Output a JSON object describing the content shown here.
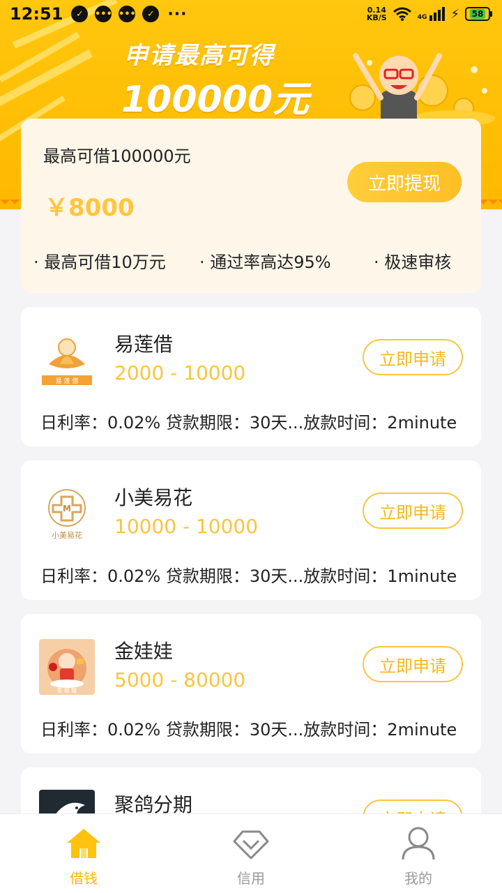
{
  "status_bar": {
    "time": "12:51",
    "speed_value": "0.14",
    "speed_unit": "KB/S",
    "network": "4G",
    "battery": "58"
  },
  "banner": {
    "title": "申请最高可得",
    "amount": "100000元"
  },
  "summary": {
    "limit_text": "最高可借100000元",
    "amount": "￥8000",
    "withdraw_label": "立即提现",
    "features": [
      "· 最高可借10万元",
      "· 通过率高达95%",
      "· 极速审核"
    ]
  },
  "products": [
    {
      "name": "易莲借",
      "range": "2000 - 10000",
      "apply_label": "立即申请",
      "info": "日利率：0.02% 贷款期限：30天...放款时间：2minute",
      "logo_text": "易莲借"
    },
    {
      "name": "小美易花",
      "range": "10000 - 10000",
      "apply_label": "立即申请",
      "info": "日利率：0.02% 贷款期限：30天...放款时间：1minute",
      "logo_text": "小美易花"
    },
    {
      "name": "金娃娃",
      "range": "5000 - 80000",
      "apply_label": "立即申请",
      "info": "日利率：0.02% 贷款期限：30天...放款时间：2minute",
      "logo_text": "金娃娃"
    },
    {
      "name": "聚鸽分期",
      "range": "",
      "apply_label": "立即申请",
      "info": "",
      "logo_text": ""
    }
  ],
  "bottom_nav": [
    {
      "label": "借钱",
      "icon": "home-icon",
      "active": true
    },
    {
      "label": "信用",
      "icon": "diamond-icon",
      "active": false
    },
    {
      "label": "我的",
      "icon": "user-icon",
      "active": false
    }
  ],
  "colors": {
    "accent": "#ffc51c",
    "price": "#f8c53f"
  }
}
